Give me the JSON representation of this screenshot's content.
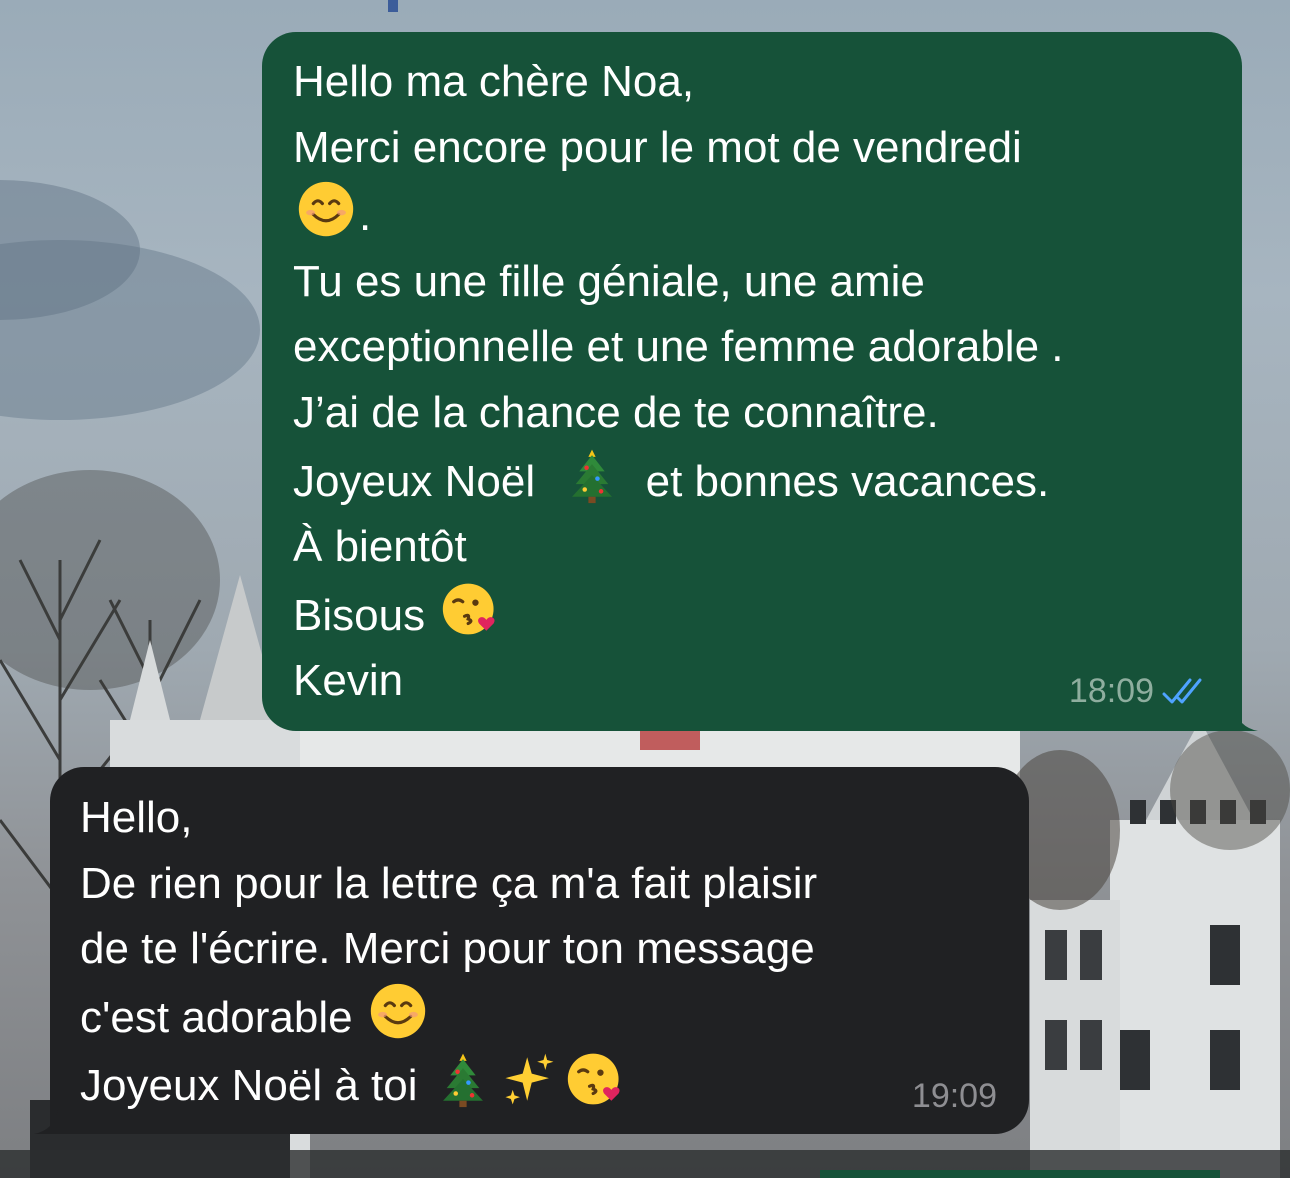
{
  "colors": {
    "outgoing_bubble": "#165239",
    "incoming_bubble": "#202123",
    "read_receipt": "#4fa3ff"
  },
  "messages": [
    {
      "direction": "outgoing",
      "lines": [
        "Hello ma chère Noa,",
        "Merci encore pour le mot de vendredi",
        ".",
        "Tu es une fille géniale, une amie",
        "exceptionnelle et une femme adorable .",
        "J’ai de la chance de te connaître.",
        "Joyeux Noël",
        "et bonnes vacances.",
        "À bientôt",
        "Bisous",
        "Kevin"
      ],
      "emojis": [
        "smiling-face-icon",
        "christmas-tree-icon",
        "kissing-face-icon"
      ],
      "time": "18:09",
      "status": "read"
    },
    {
      "direction": "incoming",
      "lines": [
        "Hello,",
        "De rien pour la lettre ça m'a fait plaisir",
        "de te l'écrire. Merci pour ton message",
        "c'est adorable",
        "Joyeux Noël à toi"
      ],
      "emojis": [
        "smiling-face-icon",
        "christmas-tree-icon",
        "sparkles-icon",
        "kissing-face-icon"
      ],
      "time": "19:09"
    }
  ]
}
